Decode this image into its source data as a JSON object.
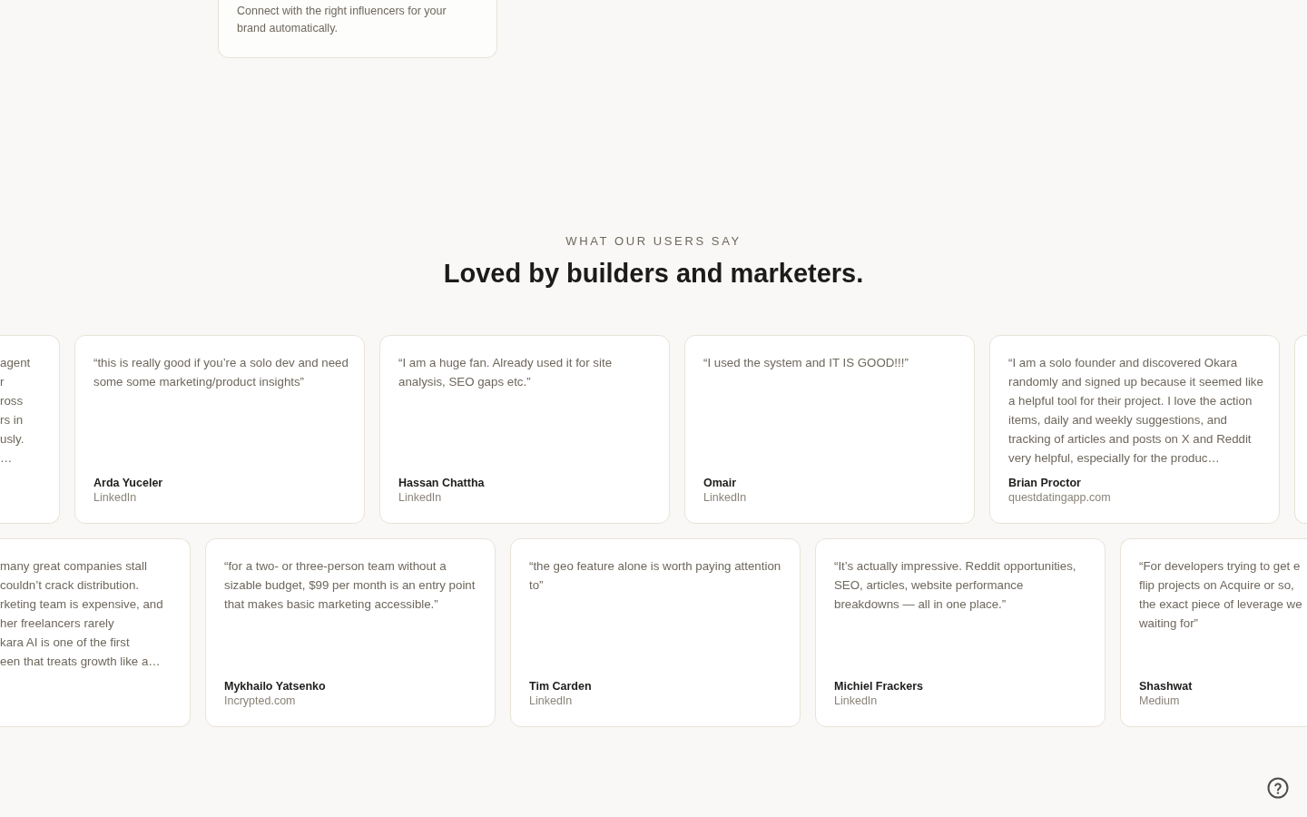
{
  "feature_card": {
    "description": "Connect with the right influencers for your brand automatically."
  },
  "section": {
    "eyebrow": "WHAT OUR USERS SAY",
    "heading": "Loved by builders and marketers."
  },
  "testimonial_rows": [
    {
      "cards": [
        {
          "kind": "cut_left",
          "lines": [
            "agent",
            "r",
            "ross",
            "rs in",
            "usly.",
            "…"
          ]
        },
        {
          "kind": "full",
          "quote": "“this is really good if you’re a solo dev and need some some marketing/product insights”",
          "name": "Arda Yuceler",
          "source": "LinkedIn"
        },
        {
          "kind": "full",
          "quote": "“I am a huge fan. Already used it for site analysis, SEO gaps etc.”",
          "name": "Hassan Chattha",
          "source": "LinkedIn"
        },
        {
          "kind": "full",
          "quote": "“I used the system and IT IS GOOD!!!”",
          "name": "Omair",
          "source": "LinkedIn"
        },
        {
          "kind": "full",
          "quote": "“I am a solo founder and discovered Okara randomly and signed up because it seemed like a helpful tool for their project. I love the action items, daily and weekly suggestions, and tracking of articles and posts on X and Reddit very helpful, especially for the produc…",
          "name": "Brian Proctor",
          "source": "questdatingapp.com"
        },
        {
          "kind": "edge"
        }
      ]
    },
    {
      "cards": [
        {
          "kind": "cut_left",
          "lines": [
            "many great companies stall",
            "couldn’t crack distribution.",
            "rketing team is expensive, and",
            "her freelancers rarely",
            "kara AI is one of the first",
            "een that treats growth like a…"
          ]
        },
        {
          "kind": "full",
          "quote": "“for a two- or three-person team without a sizable budget, $99 per month is an entry point that makes basic marketing accessible.”",
          "name": "Mykhailo Yatsenko",
          "source": "Incrypted.com"
        },
        {
          "kind": "full",
          "quote": "“the geo feature alone is worth paying attention to”",
          "name": "Tim Carden",
          "source": "LinkedIn"
        },
        {
          "kind": "full",
          "quote": "“It’s actually impressive. Reddit opportunities, SEO, articles, website performance breakdowns — all in one place.”",
          "name": "Michiel Frackers",
          "source": "LinkedIn"
        },
        {
          "kind": "cut_right",
          "lines": [
            "“For developers trying to get e",
            "flip projects on Acquire or so,",
            "the exact piece of leverage we",
            "waiting for”"
          ],
          "name": "Shashwat",
          "source": "Medium"
        }
      ]
    }
  ]
}
